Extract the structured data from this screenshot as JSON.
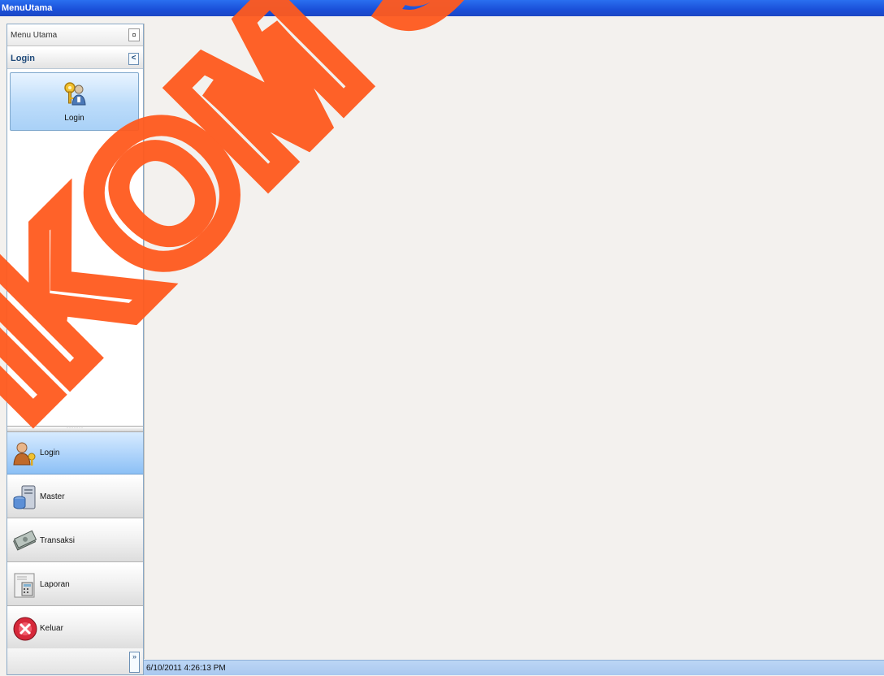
{
  "window": {
    "title": "MenuUtama"
  },
  "sidebar": {
    "header": {
      "title": "Menu Utama",
      "pin_glyph": "¤"
    },
    "group": {
      "title": "Login",
      "collapse_glyph": "<",
      "tile": {
        "label": "Login",
        "icon": "keys-user-icon"
      }
    },
    "splitter_glyph": "·······",
    "nav": [
      {
        "label": "Login",
        "icon": "user-key-icon",
        "active": true
      },
      {
        "label": "Master",
        "icon": "database-server-icon",
        "active": false
      },
      {
        "label": "Transaksi",
        "icon": "money-icon",
        "active": false
      },
      {
        "label": "Laporan",
        "icon": "calculator-icon",
        "active": false
      },
      {
        "label": "Keluar",
        "icon": "exit-icon",
        "active": false
      }
    ],
    "overflow_glyph": "»"
  },
  "status": {
    "datetime": "6/10/2011 4:26:13 PM"
  },
  "watermark": {
    "text": "IKOM SU",
    "color": "#ff5a1e"
  },
  "colors": {
    "titlebar": "#1a4fd8",
    "active_nav": "#b1d5fb",
    "status": "#bcd6f5"
  }
}
